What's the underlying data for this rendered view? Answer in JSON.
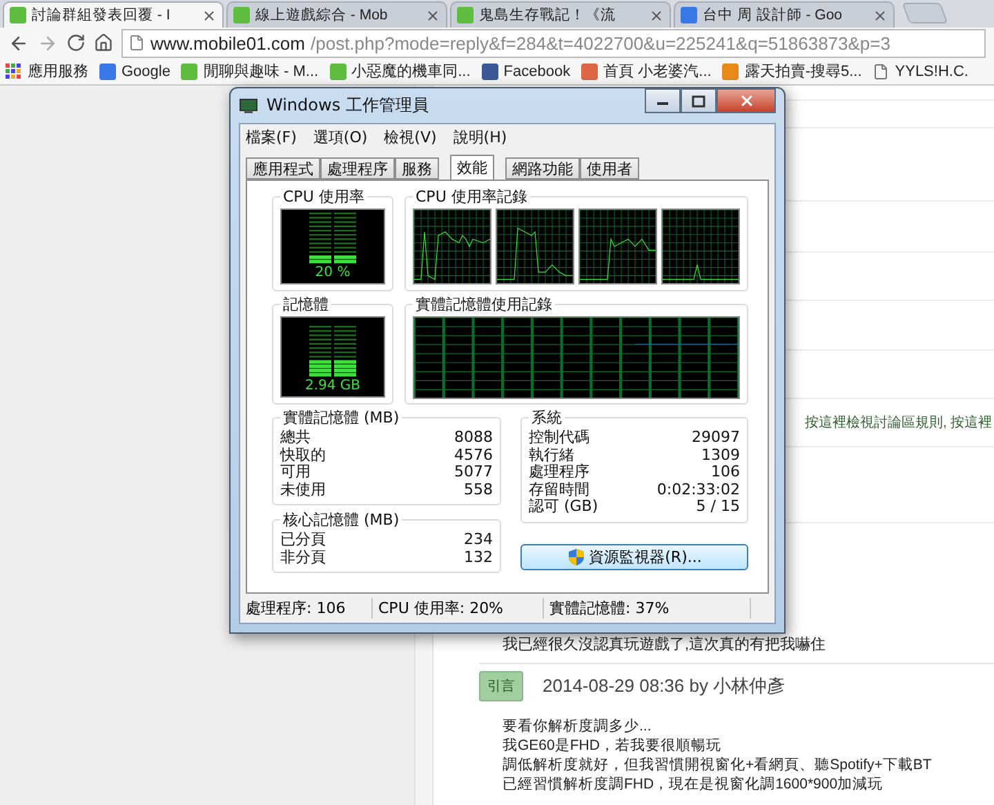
{
  "browser": {
    "tabs": [
      {
        "title": "討論群組發表回覆 - I",
        "kind": "site",
        "selected": true
      },
      {
        "title": "線上遊戲綜合 - Mob",
        "kind": "site",
        "selected": false
      },
      {
        "title": "鬼島生存戰記！《流",
        "kind": "site",
        "selected": false
      },
      {
        "title": "台中 周 設計師 - Goo",
        "kind": "google",
        "selected": false
      }
    ],
    "address": {
      "host": "www.mobile01.com",
      "path": "/post.php?mode=reply&f=284&t=4022700&u=225241&q=51863873&p=3"
    },
    "bookmarks": [
      {
        "label": "應用服務",
        "kind": "apps"
      },
      {
        "label": "Google",
        "kind": "google"
      },
      {
        "label": "閒聊與趣味 - M...",
        "kind": "site"
      },
      {
        "label": "小惡魔的機車同...",
        "kind": "site"
      },
      {
        "label": "Facebook",
        "kind": "facebook"
      },
      {
        "label": "首頁 小老婆汽...",
        "kind": "photo"
      },
      {
        "label": "露天拍賣-搜尋5...",
        "kind": "auction"
      },
      {
        "label": "YYLS!H.C.",
        "kind": "page"
      }
    ]
  },
  "page": {
    "rules_link": "按這裡檢視討論區規則, 按這裡",
    "post_tail": "我已經很久沒認真玩遊戲了,這次真的有把我嚇住",
    "quote_button": "引言",
    "reply_meta": "2014-08-29 08:36 by 小林仲彥",
    "reply_lines": [
      "要看你解析度調多少...",
      "我GE60是FHD，若我要很順暢玩",
      "調低解析度就好，但我習慣開視窗化+看網頁、聽Spotify+下載BT",
      "已經習慣解析度調FHD，現在是視窗化調1600*900加減玩"
    ]
  },
  "task_manager": {
    "title": "Windows 工作管理員",
    "menu": [
      "檔案(F)",
      "選項(O)",
      "檢視(V)",
      "說明(H)"
    ],
    "tabs": [
      {
        "label": "應用程式",
        "selected": false
      },
      {
        "label": "處理程序",
        "selected": false
      },
      {
        "label": "服務",
        "selected": false
      },
      {
        "label": "效能",
        "selected": true
      },
      {
        "label": "網路功能",
        "selected": false
      },
      {
        "label": "使用者",
        "selected": false
      }
    ],
    "cpu": {
      "label": "CPU 使用率",
      "reading": "20 %",
      "level": 0.2
    },
    "cpu_history": {
      "label": "CPU 使用率記錄"
    },
    "memory": {
      "label": "記憶體",
      "reading": "2.94 GB",
      "level": 0.37
    },
    "memory_history": {
      "label": "實體記憶體使用記錄"
    },
    "physical_memory": {
      "label": "實體記憶體 (MB)",
      "rows": [
        {
          "name": "總共",
          "value": "8088"
        },
        {
          "name": "快取的",
          "value": "4576"
        },
        {
          "name": "可用",
          "value": "5077"
        },
        {
          "name": "未使用",
          "value": "558"
        }
      ]
    },
    "kernel_memory": {
      "label": "核心記憶體 (MB)",
      "rows": [
        {
          "name": "已分頁",
          "value": "234"
        },
        {
          "name": "非分頁",
          "value": "132"
        }
      ]
    },
    "system": {
      "label": "系統",
      "rows": [
        {
          "name": "控制代碼",
          "value": "29097"
        },
        {
          "name": "執行緒",
          "value": "1309"
        },
        {
          "name": "處理程序",
          "value": "106"
        },
        {
          "name": "存留時間",
          "value": "0:02:33:02"
        },
        {
          "name": "認可 (GB)",
          "value": "5 / 15"
        }
      ]
    },
    "resource_monitor_button": "資源監視器(R)...",
    "status_bar": [
      "處理程序: 106",
      "CPU 使用率: 20%",
      "實體記憶體: 37%"
    ]
  }
}
